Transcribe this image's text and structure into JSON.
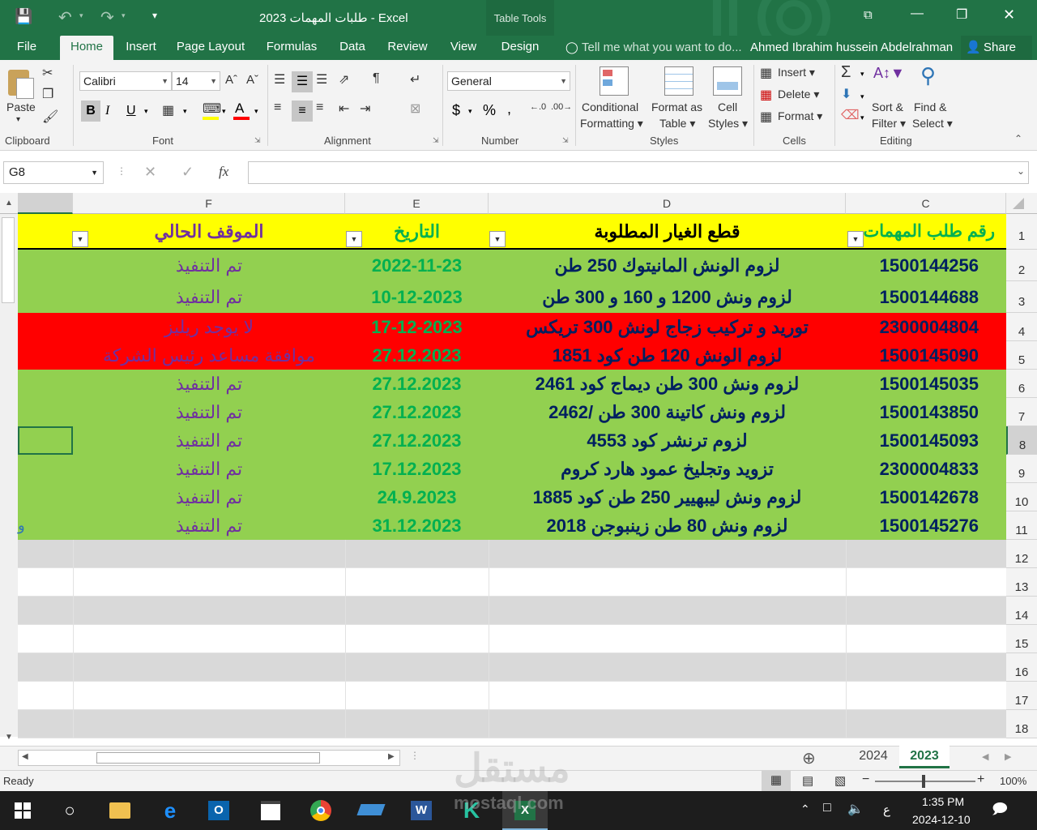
{
  "window": {
    "title": "طلبات المهمات 2023 - Excel",
    "context_tab": "Table Tools",
    "qat": {
      "save": "save-icon",
      "undo": "undo-icon",
      "redo": "redo-icon",
      "customize": "▾"
    },
    "controls": {
      "restore_ribbon": "⧉",
      "minimize": "—",
      "maximize": "❐",
      "close": "✕"
    }
  },
  "tabs": [
    "File",
    "Home",
    "Insert",
    "Page Layout",
    "Formulas",
    "Data",
    "Review",
    "View",
    "Design"
  ],
  "active_tab": "Home",
  "tell_me": "Tell me what you want to do...",
  "user": "Ahmed Ibrahim hussein Abdelrahman",
  "share": "Share",
  "ribbon": {
    "clipboard": {
      "label": "Clipboard",
      "paste": "Paste"
    },
    "font": {
      "label": "Font",
      "name": "Calibri",
      "size": "14",
      "bold": "B",
      "italic": "I",
      "underline": "U"
    },
    "alignment": {
      "label": "Alignment"
    },
    "number": {
      "label": "Number",
      "format": "General",
      "currency": "$",
      "percent": "%",
      "comma": ","
    },
    "styles": {
      "label": "Styles",
      "conditional": [
        "Conditional",
        "Formatting ▾"
      ],
      "format_table": [
        "Format as",
        "Table ▾"
      ],
      "cell_styles": [
        "Cell",
        "Styles ▾"
      ]
    },
    "cells": {
      "label": "Cells",
      "insert": "Insert ▾",
      "delete": "Delete ▾",
      "format": "Format ▾"
    },
    "editing": {
      "label": "Editing",
      "sort": [
        "Sort &",
        "Filter ▾"
      ],
      "find": [
        "Find &",
        "Select ▾"
      ]
    }
  },
  "formula_bar": {
    "name_box": "G8",
    "fx": "fx",
    "value": ""
  },
  "columns": [
    "F",
    "E",
    "D",
    "C"
  ],
  "header_row": {
    "c": "رقم طلب المهمات",
    "d": "قطع الغيار المطلوبة",
    "e": "التاريخ",
    "f": "الموقف الحالي"
  },
  "rows": [
    {
      "n": "1"
    },
    {
      "n": "2",
      "c": "1500144256",
      "d": "لزوم الونش المانيتوك 250 طن",
      "e": "2022-11-23",
      "f": "تم التنفيذ",
      "fill": "#92d050",
      "f_color": "#7030a0"
    },
    {
      "n": "3",
      "c": "1500144688",
      "d": "لزوم ونش 1200 و 160 و 300 طن",
      "e": "10-12-2023",
      "f": "تم التنفيذ",
      "fill": "#92d050",
      "f_color": "#7030a0"
    },
    {
      "n": "4",
      "c": "2300004804",
      "d": "توريد و تركيب زجاج لونش 300 تريكس",
      "e": "17-12-2023",
      "f": "لا يوجد ريليز",
      "fill": "#ff0000",
      "f_color": "#7030a0"
    },
    {
      "n": "5",
      "c": "1500145090",
      "d": "لزوم الونش 120 طن كود 1851",
      "e": "27.12.2023",
      "f": "موافقة مساعد رئيس الشركة",
      "fill": "#ff0000",
      "f_color": "#7030a0"
    },
    {
      "n": "6",
      "c": "1500145035",
      "d": "لزوم ونش 300 طن ديماج كود 2461",
      "e": "27.12.2023",
      "f": "تم التنفيذ",
      "fill": "#92d050",
      "f_color": "#7030a0"
    },
    {
      "n": "7",
      "c": "1500143850",
      "d": "لزوم ونش كاتينة 300 طن /2462",
      "e": "27.12.2023",
      "f": "تم التنفيذ",
      "fill": "#92d050",
      "f_color": "#7030a0"
    },
    {
      "n": "8",
      "c": "1500145093",
      "d": "لزوم ترنشر كود 4553",
      "e": "27.12.2023",
      "f": "تم التنفيذ",
      "fill": "#92d050",
      "f_color": "#7030a0"
    },
    {
      "n": "9",
      "c": "2300004833",
      "d": "تزويد وتجليخ عمود هارد كروم",
      "e": "17.12.2023",
      "f": "تم التنفيذ",
      "fill": "#92d050",
      "f_color": "#7030a0"
    },
    {
      "n": "10",
      "c": "1500142678",
      "d": "لزوم ونش ليبهيير 250 طن كود 1885",
      "e": "24.9.2023",
      "f": "تم التنفيذ",
      "fill": "#92d050",
      "f_color": "#7030a0"
    },
    {
      "n": "11",
      "c": "1500145276",
      "d": "لزوم ونش 80 طن زينبوجن 2018",
      "e": "31.12.2023",
      "f": "تم التنفيذ",
      "fill": "#92d050",
      "f_color": "#7030a0",
      "g": "و"
    },
    {
      "n": "12",
      "fill": "#d9d9d9"
    },
    {
      "n": "13",
      "fill": "#ffffff"
    },
    {
      "n": "14",
      "fill": "#d9d9d9"
    },
    {
      "n": "15",
      "fill": "#ffffff"
    },
    {
      "n": "16",
      "fill": "#d9d9d9"
    },
    {
      "n": "17",
      "fill": "#ffffff"
    },
    {
      "n": "18",
      "fill": "#d9d9d9"
    }
  ],
  "sheets": [
    "2024",
    "2023"
  ],
  "active_sheet": "2023",
  "status": {
    "ready": "Ready",
    "zoom": "100%"
  },
  "taskbar": {
    "time": "1:35 PM",
    "date": "2024-12-10",
    "lang": "ع"
  },
  "watermark": {
    "text": "مستقل",
    "site": "mostaql.com"
  },
  "colors": {
    "excel_green": "#217346",
    "header_fill": "#ffff00",
    "done_fill": "#92d050",
    "alert_fill": "#ff0000",
    "id_color": "#002060",
    "date_color": "#00b050",
    "header_c_color": "#00b050",
    "header_f_color": "#7030a0"
  }
}
